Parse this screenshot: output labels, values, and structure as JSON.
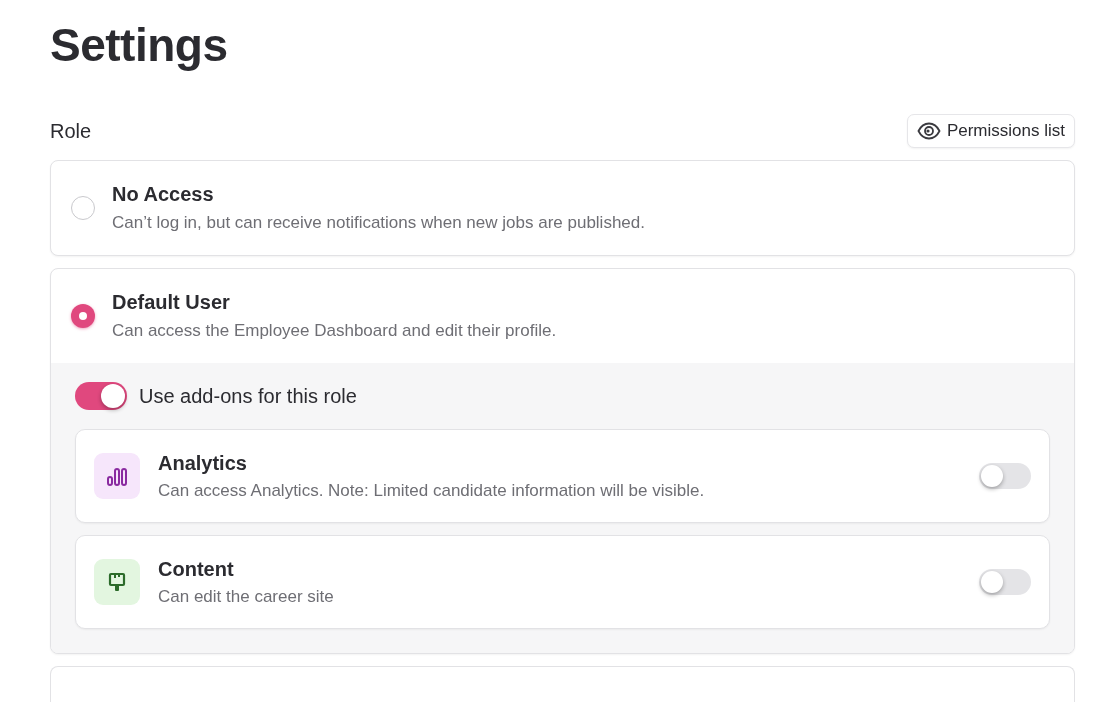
{
  "title": "Settings",
  "role_label": "Role",
  "permissions_button": "Permissions list",
  "roles": [
    {
      "name": "No Access",
      "description": "Can’t log in, but can receive notifications when new jobs are published.",
      "selected": false
    },
    {
      "name": "Default User",
      "description": "Can access the Employee Dashboard and edit their profile.",
      "selected": true,
      "addons": {
        "label": "Use add-ons for this role",
        "on": true,
        "items": [
          {
            "kind": "analytics",
            "name": "Analytics",
            "description": "Can access Analytics. Note: Limited candidate information will be visible.",
            "on": false
          },
          {
            "kind": "content",
            "name": "Content",
            "description": "Can edit the career site",
            "on": false
          }
        ]
      }
    }
  ]
}
